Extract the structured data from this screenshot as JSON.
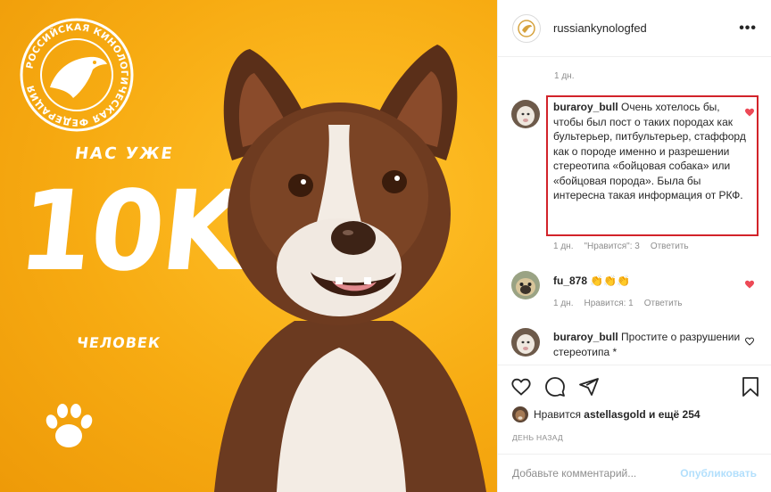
{
  "image": {
    "seal_text": "РОССИЙСКАЯ КИНОЛОГИЧЕСКАЯ ФЕДЕРАЦИЯ",
    "line1": "НАС УЖЕ",
    "big": "10K",
    "line2": "ЧЕЛОВЕК",
    "bg_color": "#f7ab12"
  },
  "header": {
    "username": "russiankynologfed",
    "more": "•••"
  },
  "time_top": "1 дн.",
  "comments": [
    {
      "user": "buraroy_bull",
      "text": "Очень хотелось бы, чтобы был пост о таких породах как бультерьер, питбультерьер, стаффорд как о породе именно и разрешении стереотипа «бойцовая собака» или «бойцовая порода». Была бы интересна такая информация от РКФ.",
      "time": "1 дн.",
      "likes": "\"Нравится\": 3",
      "reply": "Ответить",
      "liked": true
    },
    {
      "user": "fu_878",
      "text": "👏👏👏",
      "time": "1 дн.",
      "likes": "Нравится: 1",
      "reply": "Ответить",
      "liked": true
    },
    {
      "user": "buraroy_bull",
      "text": "Простите о разрушении стереотипа *",
      "liked": false
    }
  ],
  "likes": {
    "prefix": "Нравится",
    "user": "astellasgold",
    "suffix": "и ещё 254"
  },
  "date": "ДЕНЬ НАЗАД",
  "add_comment": {
    "placeholder": "Добавьте комментарий...",
    "post": "Опубликовать"
  },
  "colors": {
    "heart": "#ed4956",
    "highlight": "#d2232a",
    "post": "#b2dffc"
  }
}
